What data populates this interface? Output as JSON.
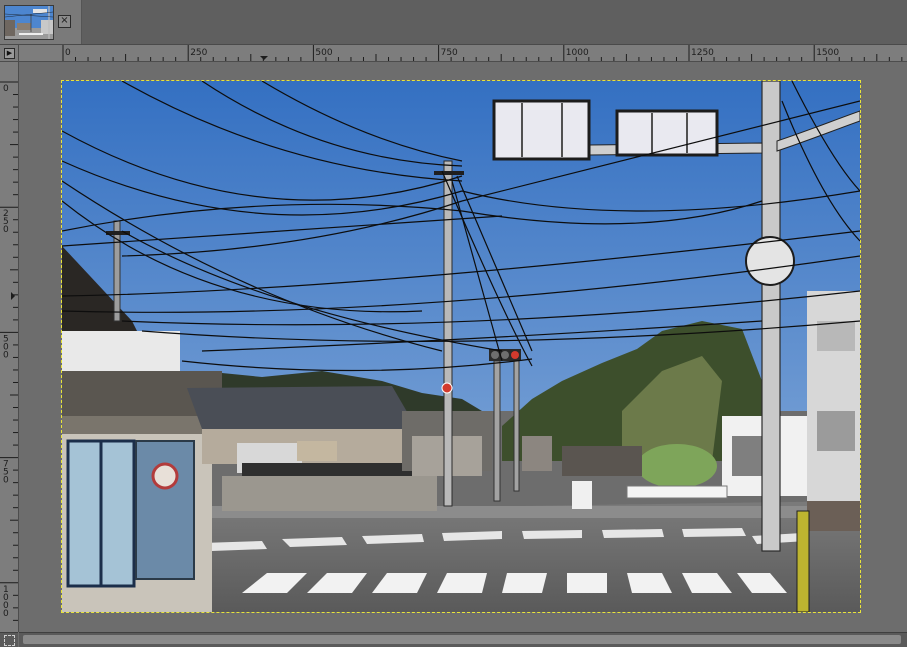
{
  "tab": {
    "thumbnail_icon": "image-thumbnail",
    "close_icon": "close-icon",
    "close_glyph": "×"
  },
  "ruler": {
    "horizontal_labels": [
      "0",
      "250",
      "500",
      "750",
      "1000",
      "1250",
      "1500"
    ],
    "vertical_labels": [
      "0",
      "250",
      "500",
      "750",
      "1000"
    ]
  },
  "image": {
    "description_icon": "street-photo-image",
    "selection_color": "#e8e43a",
    "sky_color": "#3f78c4"
  }
}
